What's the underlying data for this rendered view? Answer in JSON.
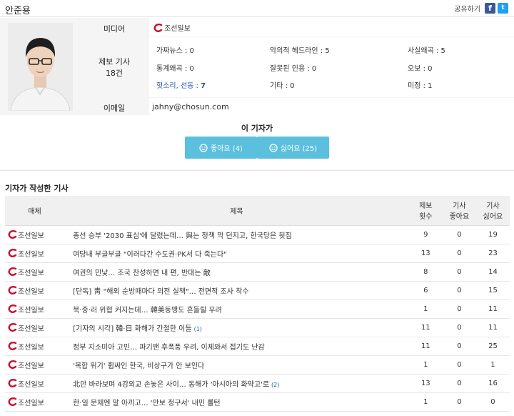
{
  "reporter": {
    "name": "안준용"
  },
  "share": {
    "label": "공유하기",
    "facebook": "f",
    "twitter": "t"
  },
  "profile": {
    "media_label": "미디어",
    "media_name": "조선일보",
    "report_label_1": "제보 기사",
    "report_label_2": "18건",
    "stats": [
      {
        "label": "가짜뉴스",
        "value": "0"
      },
      {
        "label": "악의적 헤드라인",
        "value": "5"
      },
      {
        "label": "사실왜곡",
        "value": "5"
      },
      {
        "label": "통계왜곡",
        "value": "0"
      },
      {
        "label": "잘못된 인용",
        "value": "0"
      },
      {
        "label": "오보",
        "value": "0"
      },
      {
        "label": "헛소리, 선동",
        "value": "7"
      },
      {
        "label": "기타",
        "value": "0"
      },
      {
        "label": "미정",
        "value": "1"
      }
    ],
    "email_label": "이메일",
    "email": "jahny@chosun.com"
  },
  "vote": {
    "title": "이 기자가",
    "like_label": "좋아요 (4)",
    "dislike_label": "싫어요 (25)"
  },
  "articles": {
    "section_title": "기자가 작성한 기사",
    "headers": {
      "media": "매체",
      "title": "제목",
      "reports_1": "제보",
      "reports_2": "횟수",
      "likes_1": "기사",
      "likes_2": "좋아요",
      "dislikes_1": "기사",
      "dislikes_2": "싫어요"
    },
    "rows": [
      {
        "media": "조선일보",
        "title": "총선 승부 '2030 표심'에 달렸는데… 與는 정책 막 던지고, 한국당은 뒷짐",
        "count": "",
        "reports": "9",
        "likes": "0",
        "dislikes": "19"
      },
      {
        "media": "조선일보",
        "title": "여당내 부글부글 \"이러다간 수도권·PK서 다 죽는다\"",
        "count": "",
        "reports": "13",
        "likes": "0",
        "dislikes": "23"
      },
      {
        "media": "조선일보",
        "title": "여권의 민낯… 조국 찬성하면 내 편, 반대는 敵",
        "count": "",
        "reports": "8",
        "likes": "0",
        "dislikes": "14"
      },
      {
        "media": "조선일보",
        "title": "[단독] 靑 \"해외 순방때마다 의전 실책\"… 전면적 조사 착수",
        "count": "",
        "reports": "6",
        "likes": "0",
        "dislikes": "15"
      },
      {
        "media": "조선일보",
        "title": "북·중·러 위협 커지는데… 韓美동맹도 흔들릴 우려",
        "count": "",
        "reports": "1",
        "likes": "0",
        "dislikes": "11"
      },
      {
        "media": "조선일보",
        "title": "[기자의 시각] 韓·日 화해가 간절한 이들",
        "count": "(1)",
        "reports": "11",
        "likes": "0",
        "dislikes": "11"
      },
      {
        "media": "조선일보",
        "title": "정부 지소미아 고민… 파기땐 후폭풍 우려, 이제와서 접기도 난감",
        "count": "",
        "reports": "11",
        "likes": "0",
        "dislikes": "25"
      },
      {
        "media": "조선일보",
        "title": "'복합 위기' 휩싸인 한국, 비상구가 안 보인다",
        "count": "",
        "reports": "1",
        "likes": "0",
        "dislikes": "1"
      },
      {
        "media": "조선일보",
        "title": "北만 바라보며 4강외교 손놓은 사이… 동해가 '아시아의 화약고'로",
        "count": "(2)",
        "reports": "13",
        "likes": "0",
        "dislikes": "16"
      },
      {
        "media": "조선일보",
        "title": "한·일 문제엔 말 아끼고… '안보 정구서' 내민 롤턴",
        "count": "",
        "reports": "1",
        "likes": "0",
        "dislikes": "0"
      }
    ]
  },
  "colors": {
    "accent_blue": "#2257a5",
    "button_cyan": "#5bc0de",
    "logo_red": "#c8102e",
    "facebook": "#3b5998",
    "twitter": "#1da1f2"
  }
}
